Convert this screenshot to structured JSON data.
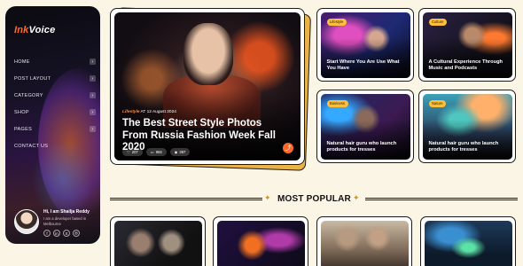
{
  "logo": {
    "part1": "Ink",
    "part2": "Voice"
  },
  "menu": [
    {
      "label": "HOME",
      "chevron": "›"
    },
    {
      "label": "POST LAYOUT",
      "chevron": "›"
    },
    {
      "label": "CATEGORY",
      "chevron": "›"
    },
    {
      "label": "SHOP",
      "chevron": "›"
    },
    {
      "label": "PAGES",
      "chevron": "›"
    },
    {
      "label": "CONTACT US",
      "chevron": ""
    }
  ],
  "profile": {
    "name": "Hi, I am Shailja Reddy",
    "bio": "I am a developer based in Melbourne",
    "socials": [
      "f",
      "in",
      "X",
      "◎"
    ]
  },
  "hero": {
    "category": "Lifestyle",
    "date_prefix": "AT",
    "date": "12 August 2024",
    "title": "The Best Street Style Photos From Russia Fashion Week Fall 2020",
    "stats": {
      "likes": "207",
      "comments": "984",
      "views": "397"
    },
    "share_icon": "share-icon"
  },
  "cards": [
    {
      "badge": "Lifestyle",
      "title": "Start Where You Are Use What You Have"
    },
    {
      "badge": "Culture",
      "title": "A Cultural Experience Through Music and Podcasts"
    },
    {
      "badge": "Business",
      "title": "Natural hair guru who launch products for tresses"
    },
    {
      "badge": "Nature",
      "title": "Natural hair guru who launch products for tresses"
    }
  ],
  "section": {
    "title": "MOST POPULAR"
  },
  "colors": {
    "accent": "#ff6a2b",
    "badge": "#ffbf3c",
    "background": "#fbf5e6",
    "gold": "#c9971e"
  }
}
